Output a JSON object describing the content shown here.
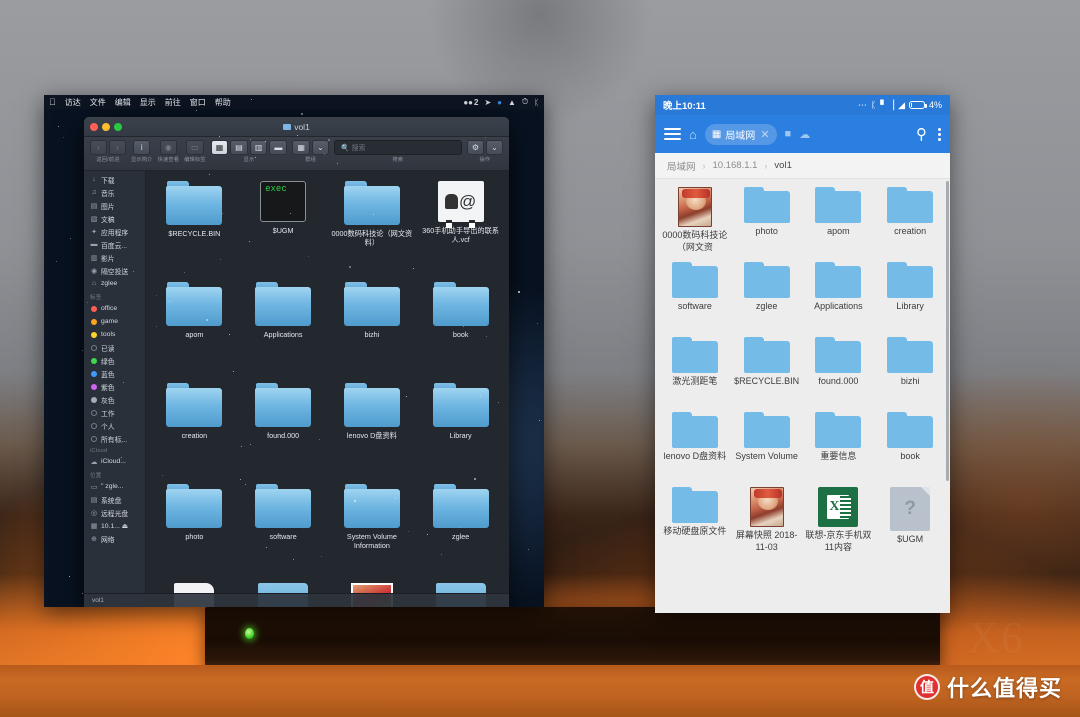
{
  "watermark": {
    "badge": "值",
    "text": "什么值得买"
  },
  "device": {
    "brand": "X6"
  },
  "mac": {
    "menubar": {
      "apple": "",
      "items": [
        "访达",
        "文件",
        "编辑",
        "显示",
        "前往",
        "窗口",
        "帮助"
      ],
      "status": [
        {
          "icon": "wechat-icon",
          "label": "2"
        },
        {
          "icon": "dropbox-icon",
          "label": ""
        },
        {
          "icon": "circle-blue-icon",
          "label": ""
        },
        {
          "icon": "mountain-icon",
          "label": ""
        },
        {
          "icon": "timemachine-icon",
          "label": ""
        },
        {
          "icon": "bluetooth-icon",
          "label": ""
        }
      ]
    },
    "finder": {
      "title": "vol1",
      "toolbar": {
        "groups": [
          {
            "label": "返回/前进",
            "buttons": [
              "‹",
              "›"
            ]
          },
          {
            "label": "显示简介",
            "buttons": [
              "i"
            ]
          },
          {
            "label": "快速查看",
            "buttons": [
              "◉"
            ]
          },
          {
            "label": "编辑标签",
            "buttons": [
              "▭"
            ]
          },
          {
            "label": "显示",
            "buttons": [
              "▦",
              "▤",
              "▥",
              "▬"
            ]
          },
          {
            "label": "群组",
            "buttons": [
              "▦",
              "⌄"
            ]
          }
        ],
        "search_label": "搜索",
        "search_placeholder": "搜索",
        "action_label": "操作",
        "action_button": "⚙",
        "action_caret": "⌄"
      },
      "sidebar": {
        "sections": [
          {
            "header": "",
            "items": [
              {
                "label": "下载",
                "icon": "download-icon"
              },
              {
                "label": "音乐",
                "icon": "music-icon"
              },
              {
                "label": "图片",
                "icon": "pictures-icon"
              },
              {
                "label": "文稿",
                "icon": "documents-icon"
              },
              {
                "label": "应用程序",
                "icon": "applications-icon"
              },
              {
                "label": "百度云...",
                "icon": "folder-icon"
              },
              {
                "label": "影片",
                "icon": "movies-icon"
              },
              {
                "label": "隔空投送",
                "icon": "airdrop-icon"
              },
              {
                "label": "zglee",
                "icon": "home-icon"
              }
            ]
          },
          {
            "header": "标签",
            "items": [
              {
                "label": "office",
                "icon": "tag-red-dot",
                "color": "#ff5f52"
              },
              {
                "label": "game",
                "icon": "tag-orange-dot",
                "color": "#ffa21f"
              },
              {
                "label": "tools",
                "icon": "tag-yellow-dot",
                "color": "#ffd426"
              },
              {
                "label": "已读",
                "icon": "tag-hollow-dot",
                "color": ""
              },
              {
                "label": "绿色",
                "icon": "tag-green-dot",
                "color": "#41d750"
              },
              {
                "label": "蓝色",
                "icon": "tag-blue-dot",
                "color": "#3f9bff"
              },
              {
                "label": "紫色",
                "icon": "tag-purple-dot",
                "color": "#d264f5"
              },
              {
                "label": "灰色",
                "icon": "tag-gray-dot",
                "color": "#a5adb8"
              },
              {
                "label": "工作",
                "icon": "tag-hollow-dot",
                "color": ""
              },
              {
                "label": "个人",
                "icon": "tag-hollow-dot",
                "color": ""
              },
              {
                "label": "所有标...",
                "icon": "tag-hollow-dot",
                "color": ""
              }
            ]
          },
          {
            "header": "iCloud",
            "items": [
              {
                "label": "iCloud...",
                "icon": "cloud-icon"
              }
            ]
          },
          {
            "header": "位置",
            "items": [
              {
                "label": "\" zgle...",
                "icon": "display-icon"
              },
              {
                "label": "系统盘",
                "icon": "harddisk-icon"
              },
              {
                "label": "远程光盘",
                "icon": "disc-icon"
              },
              {
                "label": "10.1... ⏏",
                "icon": "server-icon"
              },
              {
                "label": "网络",
                "icon": "network-icon"
              }
            ]
          }
        ]
      },
      "files": [
        {
          "name": "$RECYCLE.BIN",
          "type": "folder"
        },
        {
          "name": "$UGM",
          "type": "exec"
        },
        {
          "name": "0000数码科技论（网文资料）",
          "type": "folder"
        },
        {
          "name": "360手机助手导出的联系人.vcf",
          "type": "vcf"
        },
        {
          "name": "apom",
          "type": "folder"
        },
        {
          "name": "Applications",
          "type": "folder"
        },
        {
          "name": "bizhi",
          "type": "folder"
        },
        {
          "name": "book",
          "type": "folder"
        },
        {
          "name": "creation",
          "type": "folder"
        },
        {
          "name": "found.000",
          "type": "folder"
        },
        {
          "name": "lenovo D盘资料",
          "type": "folder"
        },
        {
          "name": "Library",
          "type": "folder"
        },
        {
          "name": "photo",
          "type": "folder"
        },
        {
          "name": "software",
          "type": "folder"
        },
        {
          "name": "System Volume Information",
          "type": "folder"
        },
        {
          "name": "zglee",
          "type": "folder"
        }
      ],
      "statusbar": {
        "label": "vol1"
      }
    }
  },
  "phone": {
    "status": {
      "time": "晚上10:11",
      "icons": [
        "...",
        "bluetooth-icon",
        "signal-icon",
        "wifi-icon",
        "battery-icon"
      ],
      "battery": "4%"
    },
    "appbar": {
      "menu_icon": "hamburger-icon",
      "home_icon": "home-icon",
      "tab_label": "局域网",
      "tab_icon": "lan-icon",
      "tab_close": "✕",
      "extra_icons": [
        "device-icon",
        "cloud-icon"
      ],
      "search_icon": "search-icon",
      "overflow_icon": "kebab-menu-icon"
    },
    "breadcrumb": [
      "局域网",
      "10.168.1.1",
      "vol1"
    ],
    "breadcrumb_sep": "›",
    "files": [
      {
        "name": "0000数码科技论（网文资",
        "type": "photo"
      },
      {
        "name": "photo",
        "type": "folder"
      },
      {
        "name": "apom",
        "type": "folder"
      },
      {
        "name": "creation",
        "type": "folder"
      },
      {
        "name": "software",
        "type": "folder"
      },
      {
        "name": "zglee",
        "type": "folder"
      },
      {
        "name": "Applications",
        "type": "folder"
      },
      {
        "name": "Library",
        "type": "folder"
      },
      {
        "name": "激光测距笔",
        "type": "folder"
      },
      {
        "name": "$RECYCLE.BIN",
        "type": "folder"
      },
      {
        "name": "found.000",
        "type": "folder"
      },
      {
        "name": "bizhi",
        "type": "folder"
      },
      {
        "name": "lenovo D盘资料",
        "type": "folder"
      },
      {
        "name": "System Volume",
        "type": "folder"
      },
      {
        "name": "重要信息",
        "type": "folder"
      },
      {
        "name": "book",
        "type": "folder"
      },
      {
        "name": "移动硬盘原文件",
        "type": "folder"
      },
      {
        "name": "屏幕快照 2018-11-03",
        "type": "photo"
      },
      {
        "name": "联想-京东手机双11内容",
        "type": "xls"
      },
      {
        "name": "$UGM",
        "type": "unknown"
      }
    ]
  },
  "colors": {
    "android_blue": "#2b7fe0",
    "status_blue": "#2979d8",
    "folder_blue": "#74bbe8",
    "mac_folder_blue": "#6fb6e2",
    "excel_green": "#1d7044",
    "accent_red": "#e03131"
  }
}
